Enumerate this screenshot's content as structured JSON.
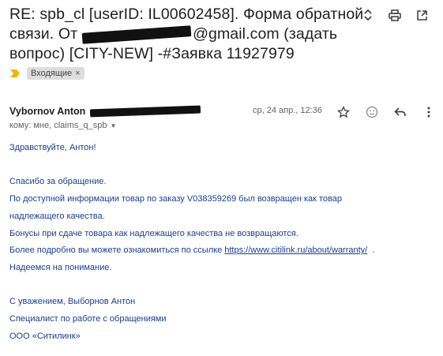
{
  "email": {
    "subject_part1": "RE: spb_cl [userID: IL00602458]. Форма обратной связи. От",
    "subject_part2": "@gmail.com (задать вопрос) [CITY-NEW] -#Заявка 11927979",
    "label": "Входящие",
    "label_remove": "×",
    "sender_name": "Vybornov Anton",
    "date": "ср, 24 апр., 12:36",
    "to_line": "кому: мне, claims_q_spb",
    "body": {
      "greeting": "Здравствуйте, Антон!",
      "line1": "Спасибо за обращение.",
      "line2": "По доступной информации товар по заказу V038359269 был возвращен как товар",
      "line3": "надлежащего качества.",
      "line4": "Бонусы при сдаче товара как надлежащего качества не возвращаются.",
      "line5_prefix": "Более подробно вы можете ознакомиться по ссылке",
      "line5_link": "https://www.citilink.ru/about/warranty/",
      "line5_suffix": ".",
      "line6": "Надеемся на понимание.",
      "sign1": "С уважением, Выборнов Антон",
      "sign2": "Специалист по работе с обращениями",
      "sign3": "ООО «Ситилинк»"
    }
  },
  "icons": {
    "expand": "unfold-icon",
    "print": "print-icon",
    "open_new": "open-in-new-window-icon",
    "important": "importance-marker-icon",
    "star": "star-icon",
    "emoji": "emoji-reaction-icon",
    "reply": "reply-icon",
    "more": "more-vert-icon"
  },
  "colors": {
    "body_text": "#1a3e8f",
    "importance": "#f4b400",
    "chip_bg": "#dddddd"
  }
}
